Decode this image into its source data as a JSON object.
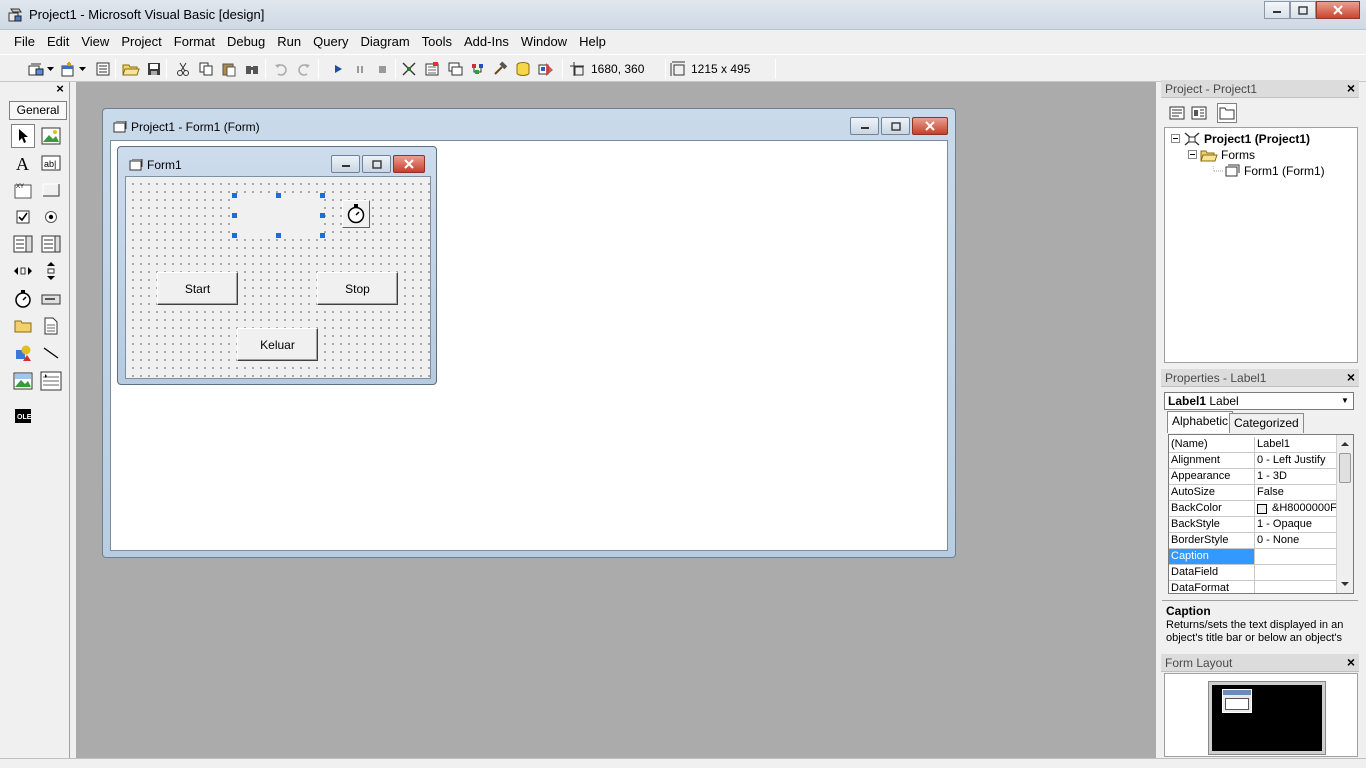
{
  "window": {
    "title": "Project1 - Microsoft Visual Basic [design]"
  },
  "menu": [
    "File",
    "Edit",
    "View",
    "Project",
    "Format",
    "Debug",
    "Run",
    "Query",
    "Diagram",
    "Tools",
    "Add-Ins",
    "Window",
    "Help"
  ],
  "toolbar": {
    "position": "1680, 360",
    "size": "1215 x 495"
  },
  "toolbox": {
    "tab_label": "General",
    "close_label": "×"
  },
  "designer": {
    "title": "Project1 - Form1 (Form)"
  },
  "form1": {
    "title": "Form1",
    "buttons": {
      "start": "Start",
      "stop": "Stop",
      "keluar": "Keluar"
    }
  },
  "project_panel": {
    "title": "Project - Project1",
    "close_label": "×",
    "tree": {
      "root": "Project1 (Project1)",
      "folder": "Forms",
      "form": "Form1 (Form1)"
    }
  },
  "properties_panel": {
    "title": "Properties - Label1",
    "close_label": "×",
    "object_name": "Label1",
    "object_type": "Label",
    "tabs": [
      "Alphabetic",
      "Categorized"
    ],
    "rows": [
      {
        "name": "(Name)",
        "value": "Label1"
      },
      {
        "name": "Alignment",
        "value": "0 - Left Justify"
      },
      {
        "name": "Appearance",
        "value": "1 - 3D"
      },
      {
        "name": "AutoSize",
        "value": "False"
      },
      {
        "name": "BackColor",
        "value": "&H8000000F"
      },
      {
        "name": "BackStyle",
        "value": "1 - Opaque"
      },
      {
        "name": "BorderStyle",
        "value": "0 - None"
      },
      {
        "name": "Caption",
        "value": ""
      },
      {
        "name": "DataField",
        "value": ""
      },
      {
        "name": "DataFormat",
        "value": ""
      }
    ],
    "description": {
      "title": "Caption",
      "text": "Returns/sets the text displayed in an object's title bar or below an object's"
    }
  },
  "form_layout": {
    "title": "Form Layout",
    "close_label": "×"
  },
  "colors": {
    "selection": "#3399ff",
    "handle": "#1e6cd8",
    "mdi_background": "#ababab"
  }
}
